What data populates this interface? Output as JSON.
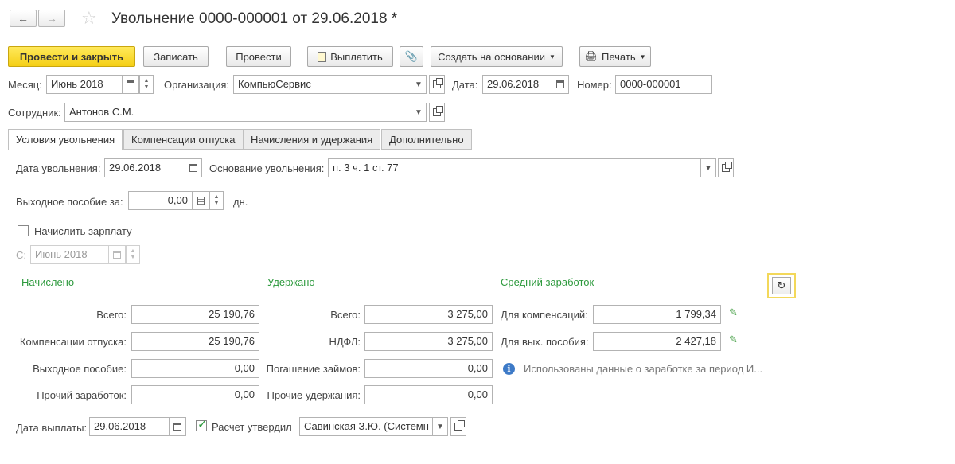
{
  "header": {
    "title": "Увольнение 0000-000001 от 29.06.2018 *"
  },
  "toolbar": {
    "post_close": "Провести и закрыть",
    "write": "Записать",
    "post": "Провести",
    "pay": "Выплатить",
    "create_based": "Создать на основании",
    "print": "Печать"
  },
  "doc": {
    "month_label": "Месяц:",
    "month_value": "Июнь 2018",
    "org_label": "Организация:",
    "org_value": "КомпьюСервис",
    "date_label": "Дата:",
    "date_value": "29.06.2018",
    "number_label": "Номер:",
    "number_value": "0000-000001",
    "employee_label": "Сотрудник:",
    "employee_value": "Антонов С.М."
  },
  "tabs": [
    {
      "label": "Условия увольнения",
      "active": true
    },
    {
      "label": "Компенсации отпуска",
      "active": false
    },
    {
      "label": "Начисления и удержания",
      "active": false
    },
    {
      "label": "Дополнительно",
      "active": false
    }
  ],
  "conditions": {
    "dismissal_date_label": "Дата увольнения:",
    "dismissal_date_value": "29.06.2018",
    "reason_label": "Основание увольнения:",
    "reason_value": "п. 3 ч. 1 ст. 77",
    "severance_label": "Выходное пособие за:",
    "severance_value": "0,00",
    "severance_unit": "дн.",
    "accrue_salary_label": "Начислить зарплату",
    "accrue_salary_checked": false,
    "from_label": "С:",
    "from_value": "Июнь 2018"
  },
  "accrued": {
    "heading": "Начислено",
    "rows": [
      {
        "label": "Всего:",
        "value": "25 190,76"
      },
      {
        "label": "Компенсации отпуска:",
        "value": "25 190,76"
      },
      {
        "label": "Выходное пособие:",
        "value": "0,00"
      },
      {
        "label": "Прочий заработок:",
        "value": "0,00"
      }
    ]
  },
  "withheld": {
    "heading": "Удержано",
    "rows": [
      {
        "label": "Всего:",
        "value": "3 275,00"
      },
      {
        "label": "НДФЛ:",
        "value": "3 275,00"
      },
      {
        "label": "Погашение займов:",
        "value": "0,00"
      },
      {
        "label": "Прочие удержания:",
        "value": "0,00"
      }
    ]
  },
  "average": {
    "heading": "Средний заработок",
    "rows": [
      {
        "label": "Для компенсаций:",
        "value": "1 799,34"
      },
      {
        "label": "Для вых. пособия:",
        "value": "2 427,18"
      }
    ],
    "info_text": "Использованы данные о заработке за период И..."
  },
  "footer": {
    "pay_date_label": "Дата выплаты:",
    "pay_date_value": "29.06.2018",
    "approved_label": "Расчет утвердил",
    "approved_checked": true,
    "approver_value": "Савинская З.Ю. (Системн"
  },
  "colors": {
    "primary_button": "#f5cf16",
    "section_heading": "#2e9a3e",
    "info_icon": "#3d7ac7"
  }
}
